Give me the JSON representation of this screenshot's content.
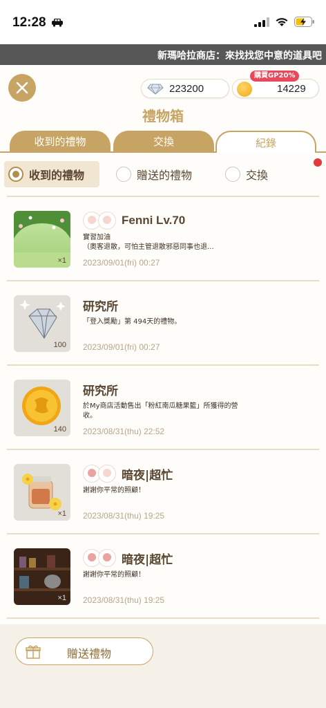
{
  "status_bar": {
    "time": "12:28"
  },
  "marquee": {
    "text": "新瑪哈拉商店：來找找您中意的道具吧"
  },
  "header": {
    "title": "禮物箱",
    "gems": "223200",
    "coins": "14229",
    "gp_badge": "購買GP20%",
    "gem_icon": "diamond-icon",
    "coin_icon": "coin-icon"
  },
  "tabs": [
    {
      "label": "收到的禮物"
    },
    {
      "label": "交換"
    },
    {
      "label": "紀錄",
      "active": true
    }
  ],
  "filters": [
    {
      "label": "收到的禮物",
      "selected": true
    },
    {
      "label": "贈送的禮物",
      "selected": false
    },
    {
      "label": "交換",
      "selected": false
    }
  ],
  "items": [
    {
      "sender": "Fenni Lv.70",
      "message": "實習加油\n（奧客退散，可怕主管退散邪惡同事也退...",
      "date": "2023/09/01(fri) 00:27",
      "qty": "×1"
    },
    {
      "sender": "研究所",
      "message": "「登入獎勵」第 494天的禮物。",
      "date": "2023/09/01(fri) 00:27",
      "qty": "100"
    },
    {
      "sender": "研究所",
      "message": "於My商店活動售出「粉紅南瓜糖果籃」所獲得的營收。",
      "date": "2023/08/31(thu) 22:52",
      "qty": "140"
    },
    {
      "sender": "暗夜|超忙",
      "message": "謝謝你平常的照顧！",
      "date": "2023/08/31(thu) 19:25",
      "qty": "×1"
    },
    {
      "sender": "暗夜|超忙",
      "message": "謝謝你平常的照顧！",
      "date": "2023/08/31(thu) 19:25",
      "qty": "×1"
    }
  ],
  "footer": {
    "gift_button": "贈送禮物"
  },
  "colors": {
    "accent": "#c7a464",
    "marquee_bg": "#575757",
    "badge": "#e8485a"
  }
}
